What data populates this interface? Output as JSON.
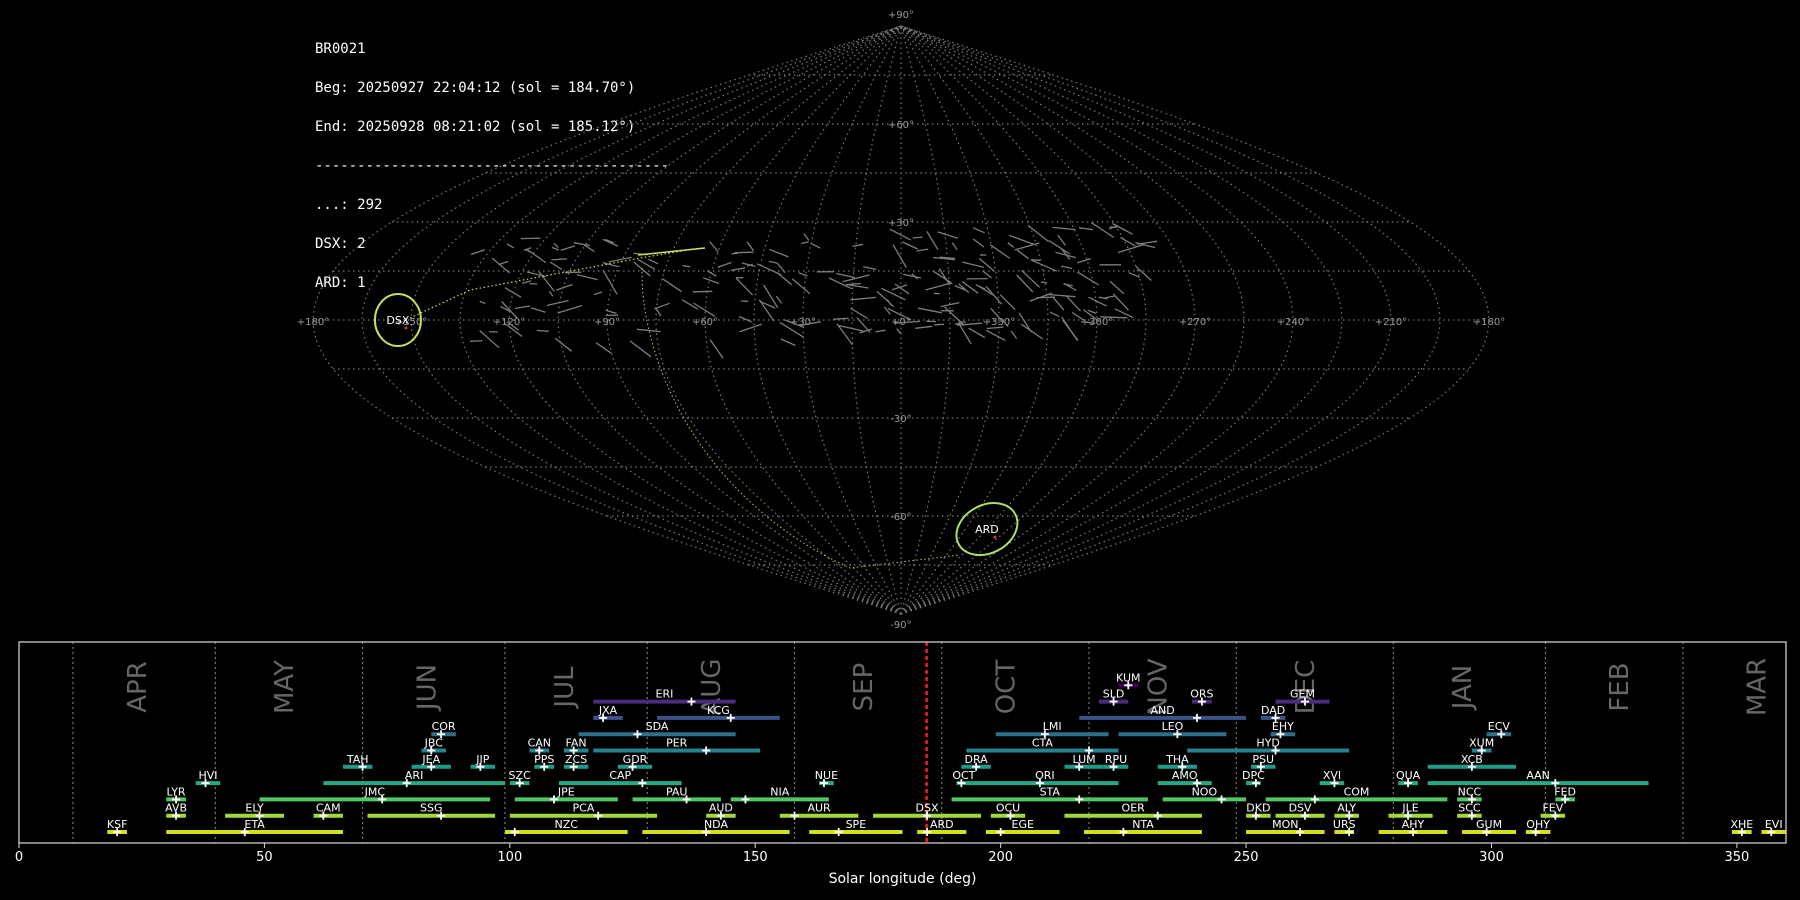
{
  "header": {
    "lines": [
      "BR0021",
      "Beg: 20250927 22:04:12 (sol = 184.70°)",
      "End: 20250928 08:21:02 (sol = 185.12°)",
      "------------------------------------------",
      "...: 292",
      "DSX: 2",
      "ARD: 1"
    ]
  },
  "sky_map": {
    "projection": "sinusoidal",
    "grid": true,
    "lon_labels": [
      "+180°",
      "+150°",
      "+120°",
      "+90°",
      "+60°",
      "+30°",
      "+0°",
      "+330°",
      "+300°",
      "+270°",
      "+240°",
      "+210°",
      "+180°"
    ],
    "lat_labels": [
      "+90°",
      "+60°",
      "+30°",
      "-30°",
      "-60°",
      "-90°"
    ],
    "radiants": [
      {
        "code": "DSX",
        "lon": 154,
        "lat": 0,
        "color": "#c8e05a"
      },
      {
        "code": "ARD",
        "lon": -60,
        "lat": -64,
        "color": "#a8e06a"
      }
    ]
  },
  "chart_data": {
    "type": "timeline",
    "xlabel": "Solar longitude (deg)",
    "xlim": [
      0,
      360
    ],
    "xticks": [
      0,
      50,
      100,
      150,
      200,
      250,
      300,
      350
    ],
    "current_sol": [
      184.7,
      185.12
    ],
    "months": [
      {
        "name": "APR",
        "start": 11,
        "mid": 24
      },
      {
        "name": "MAY",
        "start": 40,
        "mid": 54
      },
      {
        "name": "JUN",
        "start": 70,
        "mid": 83
      },
      {
        "name": "JUL",
        "start": 99,
        "mid": 111
      },
      {
        "name": "AUG",
        "start": 128,
        "mid": 141
      },
      {
        "name": "SEP",
        "start": 158,
        "mid": 172
      },
      {
        "name": "OCT",
        "start": 188,
        "mid": 201
      },
      {
        "name": "NOV",
        "start": 218,
        "mid": 232
      },
      {
        "name": "DEC",
        "start": 248,
        "mid": 262
      },
      {
        "name": "JAN",
        "start": 280,
        "mid": 294
      },
      {
        "name": "FEB",
        "start": 311,
        "mid": 326
      },
      {
        "name": "MAR",
        "start": 339,
        "mid": 354
      }
    ],
    "showers": [
      {
        "code": "KSF",
        "row": 0,
        "s": 18,
        "e": 22,
        "p": 20
      },
      {
        "code": "ETA",
        "row": 0,
        "s": 30,
        "e": 66,
        "p": 46
      },
      {
        "code": "NZC",
        "row": 0,
        "s": 99,
        "e": 124,
        "p": 101
      },
      {
        "code": "NDA",
        "row": 0,
        "s": 127,
        "e": 157,
        "p": 140
      },
      {
        "code": "SPE",
        "row": 0,
        "s": 161,
        "e": 180,
        "p": 167
      },
      {
        "code": "ARD",
        "row": 0,
        "s": 183,
        "e": 193,
        "p": 185
      },
      {
        "code": "EGE",
        "row": 0,
        "s": 197,
        "e": 212,
        "p": 200
      },
      {
        "code": "NTA",
        "row": 0,
        "s": 217,
        "e": 241,
        "p": 225
      },
      {
        "code": "MON",
        "row": 0,
        "s": 250,
        "e": 266,
        "p": 261
      },
      {
        "code": "URS",
        "row": 0,
        "s": 268,
        "e": 272,
        "p": 271
      },
      {
        "code": "AHY",
        "row": 0,
        "s": 277,
        "e": 291,
        "p": 284
      },
      {
        "code": "GUM",
        "row": 0,
        "s": 294,
        "e": 305,
        "p": 299
      },
      {
        "code": "OHY",
        "row": 0,
        "s": 307,
        "e": 312,
        "p": 309
      },
      {
        "code": "XHE",
        "row": 0,
        "s": 349,
        "e": 353,
        "p": 351
      },
      {
        "code": "EVI",
        "row": 0,
        "s": 355,
        "e": 360,
        "p": 357
      },
      {
        "code": "AVB",
        "row": 1,
        "s": 30,
        "e": 34,
        "p": 32
      },
      {
        "code": "ELY",
        "row": 1,
        "s": 42,
        "e": 54,
        "p": 49
      },
      {
        "code": "CAM",
        "row": 1,
        "s": 60,
        "e": 66,
        "p": 62
      },
      {
        "code": "SSG",
        "row": 1,
        "s": 71,
        "e": 97,
        "p": 86
      },
      {
        "code": "PCA",
        "row": 1,
        "s": 100,
        "e": 130,
        "p": 118
      },
      {
        "code": "AUD",
        "row": 1,
        "s": 140,
        "e": 146,
        "p": 143
      },
      {
        "code": "AUR",
        "row": 1,
        "s": 155,
        "e": 171,
        "p": 158
      },
      {
        "code": "DSX",
        "row": 1,
        "s": 174,
        "e": 196,
        "p": 185
      },
      {
        "code": "OCU",
        "row": 1,
        "s": 198,
        "e": 205,
        "p": 202
      },
      {
        "code": "OER",
        "row": 1,
        "s": 213,
        "e": 241,
        "p": 232
      },
      {
        "code": "DKD",
        "row": 1,
        "s": 250,
        "e": 255,
        "p": 252
      },
      {
        "code": "DSV",
        "row": 1,
        "s": 256,
        "e": 266,
        "p": 262
      },
      {
        "code": "ALY",
        "row": 1,
        "s": 268,
        "e": 273,
        "p": 271
      },
      {
        "code": "JLE",
        "row": 1,
        "s": 279,
        "e": 288,
        "p": 283
      },
      {
        "code": "SCC",
        "row": 1,
        "s": 293,
        "e": 298,
        "p": 296
      },
      {
        "code": "FEV",
        "row": 1,
        "s": 310,
        "e": 315,
        "p": 313
      },
      {
        "code": "LYR",
        "row": 2,
        "s": 30,
        "e": 34,
        "p": 32
      },
      {
        "code": "JMC",
        "row": 2,
        "s": 49,
        "e": 96,
        "p": 74
      },
      {
        "code": "JPE",
        "row": 2,
        "s": 101,
        "e": 122,
        "p": 109
      },
      {
        "code": "PAU",
        "row": 2,
        "s": 125,
        "e": 143,
        "p": 136
      },
      {
        "code": "NIA",
        "row": 2,
        "s": 145,
        "e": 165,
        "p": 148
      },
      {
        "code": "STA",
        "row": 2,
        "s": 190,
        "e": 230,
        "p": 216
      },
      {
        "code": "NOO",
        "row": 2,
        "s": 233,
        "e": 250,
        "p": 245
      },
      {
        "code": "COM",
        "row": 2,
        "s": 254,
        "e": 291,
        "p": 264
      },
      {
        "code": "NCC",
        "row": 2,
        "s": 293,
        "e": 298,
        "p": 296
      },
      {
        "code": "FED",
        "row": 2,
        "s": 313,
        "e": 317,
        "p": 315
      },
      {
        "code": "HVI",
        "row": 3,
        "s": 36,
        "e": 41,
        "p": 38
      },
      {
        "code": "ARI",
        "row": 3,
        "s": 62,
        "e": 99,
        "p": 79
      },
      {
        "code": "SZC",
        "row": 3,
        "s": 100,
        "e": 104,
        "p": 102
      },
      {
        "code": "CAP",
        "row": 3,
        "s": 110,
        "e": 135,
        "p": 127
      },
      {
        "code": "NUE",
        "row": 3,
        "s": 163,
        "e": 166,
        "p": 164
      },
      {
        "code": "OCT",
        "row": 3,
        "s": 191,
        "e": 194,
        "p": 192
      },
      {
        "code": "ORI",
        "row": 3,
        "s": 194,
        "e": 224,
        "p": 208
      },
      {
        "code": "AMO",
        "row": 3,
        "s": 232,
        "e": 243,
        "p": 240
      },
      {
        "code": "DPC",
        "row": 3,
        "s": 250,
        "e": 253,
        "p": 252
      },
      {
        "code": "XVI",
        "row": 3,
        "s": 265,
        "e": 270,
        "p": 268
      },
      {
        "code": "QUA",
        "row": 3,
        "s": 281,
        "e": 285,
        "p": 283
      },
      {
        "code": "AAN",
        "row": 3,
        "s": 287,
        "e": 332,
        "p": 313
      },
      {
        "code": "TAH",
        "row": 4,
        "s": 66,
        "e": 72,
        "p": 70
      },
      {
        "code": "JEA",
        "row": 4,
        "s": 80,
        "e": 88,
        "p": 84
      },
      {
        "code": "JIP",
        "row": 4,
        "s": 92,
        "e": 97,
        "p": 94
      },
      {
        "code": "PPS",
        "row": 4,
        "s": 105,
        "e": 109,
        "p": 107
      },
      {
        "code": "ZCS",
        "row": 4,
        "s": 111,
        "e": 116,
        "p": 113
      },
      {
        "code": "GDR",
        "row": 4,
        "s": 122,
        "e": 129,
        "p": 125
      },
      {
        "code": "DRA",
        "row": 4,
        "s": 192,
        "e": 198,
        "p": 195
      },
      {
        "code": "LUM",
        "row": 4,
        "s": 213,
        "e": 221,
        "p": 216
      },
      {
        "code": "RPU",
        "row": 4,
        "s": 221,
        "e": 226,
        "p": 223
      },
      {
        "code": "THA",
        "row": 4,
        "s": 232,
        "e": 240,
        "p": 237
      },
      {
        "code": "PSU",
        "row": 4,
        "s": 251,
        "e": 256,
        "p": 253
      },
      {
        "code": "XCB",
        "row": 4,
        "s": 287,
        "e": 305,
        "p": 296
      },
      {
        "code": "JBC",
        "row": 5,
        "s": 82,
        "e": 87,
        "p": 84
      },
      {
        "code": "CAN",
        "row": 5,
        "s": 104,
        "e": 108,
        "p": 106
      },
      {
        "code": "FAN",
        "row": 5,
        "s": 111,
        "e": 116,
        "p": 113
      },
      {
        "code": "PER",
        "row": 5,
        "s": 117,
        "e": 151,
        "p": 140
      },
      {
        "code": "CTA",
        "row": 5,
        "s": 193,
        "e": 224,
        "p": 218
      },
      {
        "code": "HYD",
        "row": 5,
        "s": 238,
        "e": 271,
        "p": 256
      },
      {
        "code": "XUM",
        "row": 5,
        "s": 296,
        "e": 300,
        "p": 298
      },
      {
        "code": "COR",
        "row": 6,
        "s": 84,
        "e": 89,
        "p": 86
      },
      {
        "code": "SDA",
        "row": 6,
        "s": 114,
        "e": 146,
        "p": 126
      },
      {
        "code": "LMI",
        "row": 6,
        "s": 199,
        "e": 222,
        "p": 209
      },
      {
        "code": "LEO",
        "row": 6,
        "s": 224,
        "e": 246,
        "p": 236
      },
      {
        "code": "EHY",
        "row": 6,
        "s": 255,
        "e": 260,
        "p": 257
      },
      {
        "code": "ECV",
        "row": 6,
        "s": 299,
        "e": 304,
        "p": 302
      },
      {
        "code": "JXA",
        "row": 7,
        "s": 117,
        "e": 123,
        "p": 119
      },
      {
        "code": "KCG",
        "row": 7,
        "s": 130,
        "e": 155,
        "p": 145
      },
      {
        "code": "AND",
        "row": 7,
        "s": 216,
        "e": 250,
        "p": 240
      },
      {
        "code": "DAD",
        "row": 7,
        "s": 253,
        "e": 258,
        "p": 256
      },
      {
        "code": "ERI",
        "row": 8,
        "s": 117,
        "e": 146,
        "p": 137
      },
      {
        "code": "SLD",
        "row": 8,
        "s": 220,
        "e": 226,
        "p": 223
      },
      {
        "code": "ORS",
        "row": 8,
        "s": 239,
        "e": 243,
        "p": 241
      },
      {
        "code": "GEM",
        "row": 8,
        "s": 256,
        "e": 267,
        "p": 262
      },
      {
        "code": "KUM",
        "row": 9,
        "s": 224,
        "e": 228,
        "p": 226
      }
    ]
  }
}
